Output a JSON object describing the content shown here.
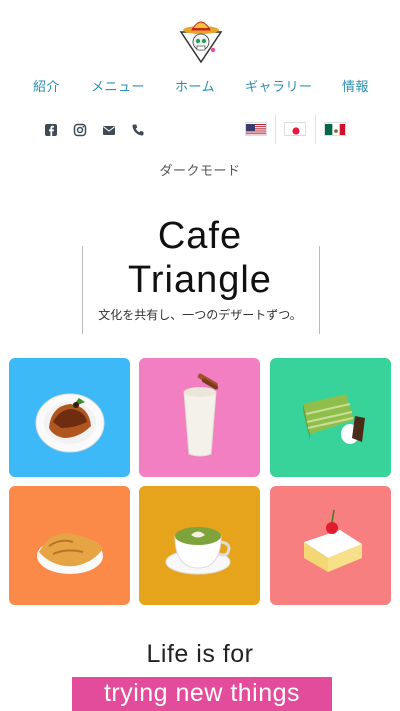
{
  "logo": {
    "icon": "sugar-skull-sombrero-triangle-logo"
  },
  "nav": {
    "items": [
      {
        "label": "紹介"
      },
      {
        "label": "メニュー"
      },
      {
        "label": "ホーム"
      },
      {
        "label": "ギャラリー"
      },
      {
        "label": "情報"
      }
    ]
  },
  "social": [
    {
      "icon": "facebook-icon"
    },
    {
      "icon": "instagram-icon"
    },
    {
      "icon": "mail-icon"
    },
    {
      "icon": "phone-icon"
    }
  ],
  "languages": [
    {
      "icon": "us-flag-icon"
    },
    {
      "icon": "japan-flag-icon"
    },
    {
      "icon": "mexico-flag-icon"
    }
  ],
  "dark_mode_label": "ダークモード",
  "hero": {
    "title_line1": "Cafe",
    "title_line2": "Triangle",
    "subtitle": "文化を共有し、一つのデザートずつ。"
  },
  "gallery": [
    {
      "item": "flan-dessert",
      "color": "#3db9f7"
    },
    {
      "item": "horchata-drink",
      "color": "#f17fc1"
    },
    {
      "item": "matcha-crepe-cake",
      "color": "#38d39a"
    },
    {
      "item": "taiyaki",
      "color": "#fb8a48"
    },
    {
      "item": "matcha-latte",
      "color": "#e6a41c"
    },
    {
      "item": "tres-leches-cake",
      "color": "#f87f80"
    }
  ],
  "tagline": {
    "line1": "Life is for",
    "line2": "trying new things",
    "highlight_color": "#e34c9b"
  }
}
